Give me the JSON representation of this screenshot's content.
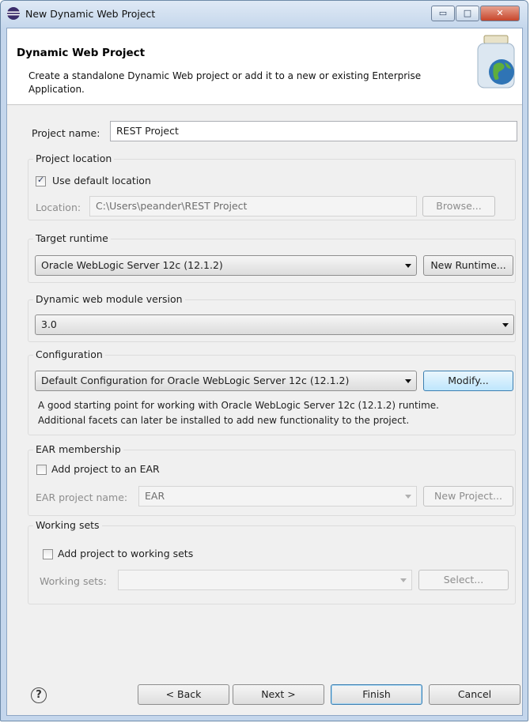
{
  "window": {
    "title": "New Dynamic Web Project",
    "controls": {
      "minimize": "▭",
      "maximize": "□",
      "close": "✕"
    }
  },
  "header": {
    "title": "Dynamic Web Project",
    "description": "Create a standalone Dynamic Web project or add it to a new or existing Enterprise Application."
  },
  "project_name": {
    "label": "Project name:",
    "value": "REST Project"
  },
  "project_location": {
    "group_title": "Project location",
    "use_default": {
      "label": "Use default location",
      "checked": true
    },
    "location_label": "Location:",
    "location_value": "C:\\Users\\peander\\REST Project",
    "browse_label": "Browse..."
  },
  "target_runtime": {
    "group_title": "Target runtime",
    "selected": "Oracle WebLogic Server 12c (12.1.2)",
    "new_runtime_label": "New Runtime..."
  },
  "module_version": {
    "group_title": "Dynamic web module version",
    "selected": "3.0"
  },
  "configuration": {
    "group_title": "Configuration",
    "selected": "Default Configuration for Oracle WebLogic Server 12c (12.1.2)",
    "modify_label": "Modify...",
    "description_line1": "A good starting point for working with Oracle WebLogic Server 12c (12.1.2) runtime.",
    "description_line2": "Additional facets can later be installed to add new functionality to the project."
  },
  "ear_membership": {
    "group_title": "EAR membership",
    "add_to_ear": {
      "label": "Add project to an EAR",
      "checked": false
    },
    "ear_name_label": "EAR project name:",
    "ear_name_value": "EAR",
    "new_project_label": "New Project..."
  },
  "working_sets": {
    "group_title": "Working sets",
    "add_to_sets": {
      "label": "Add project to working sets",
      "checked": false
    },
    "sets_label": "Working sets:",
    "sets_value": "",
    "select_label": "Select..."
  },
  "footer": {
    "help_icon": "?",
    "back_label": "< Back",
    "next_label": "Next >",
    "finish_label": "Finish",
    "cancel_label": "Cancel"
  },
  "colors": {
    "title_bar": "#c5d7ec",
    "dialog_background": "#f0f0f0",
    "focus_accent": "#3c7fb1",
    "close_button": "#c7452b"
  }
}
